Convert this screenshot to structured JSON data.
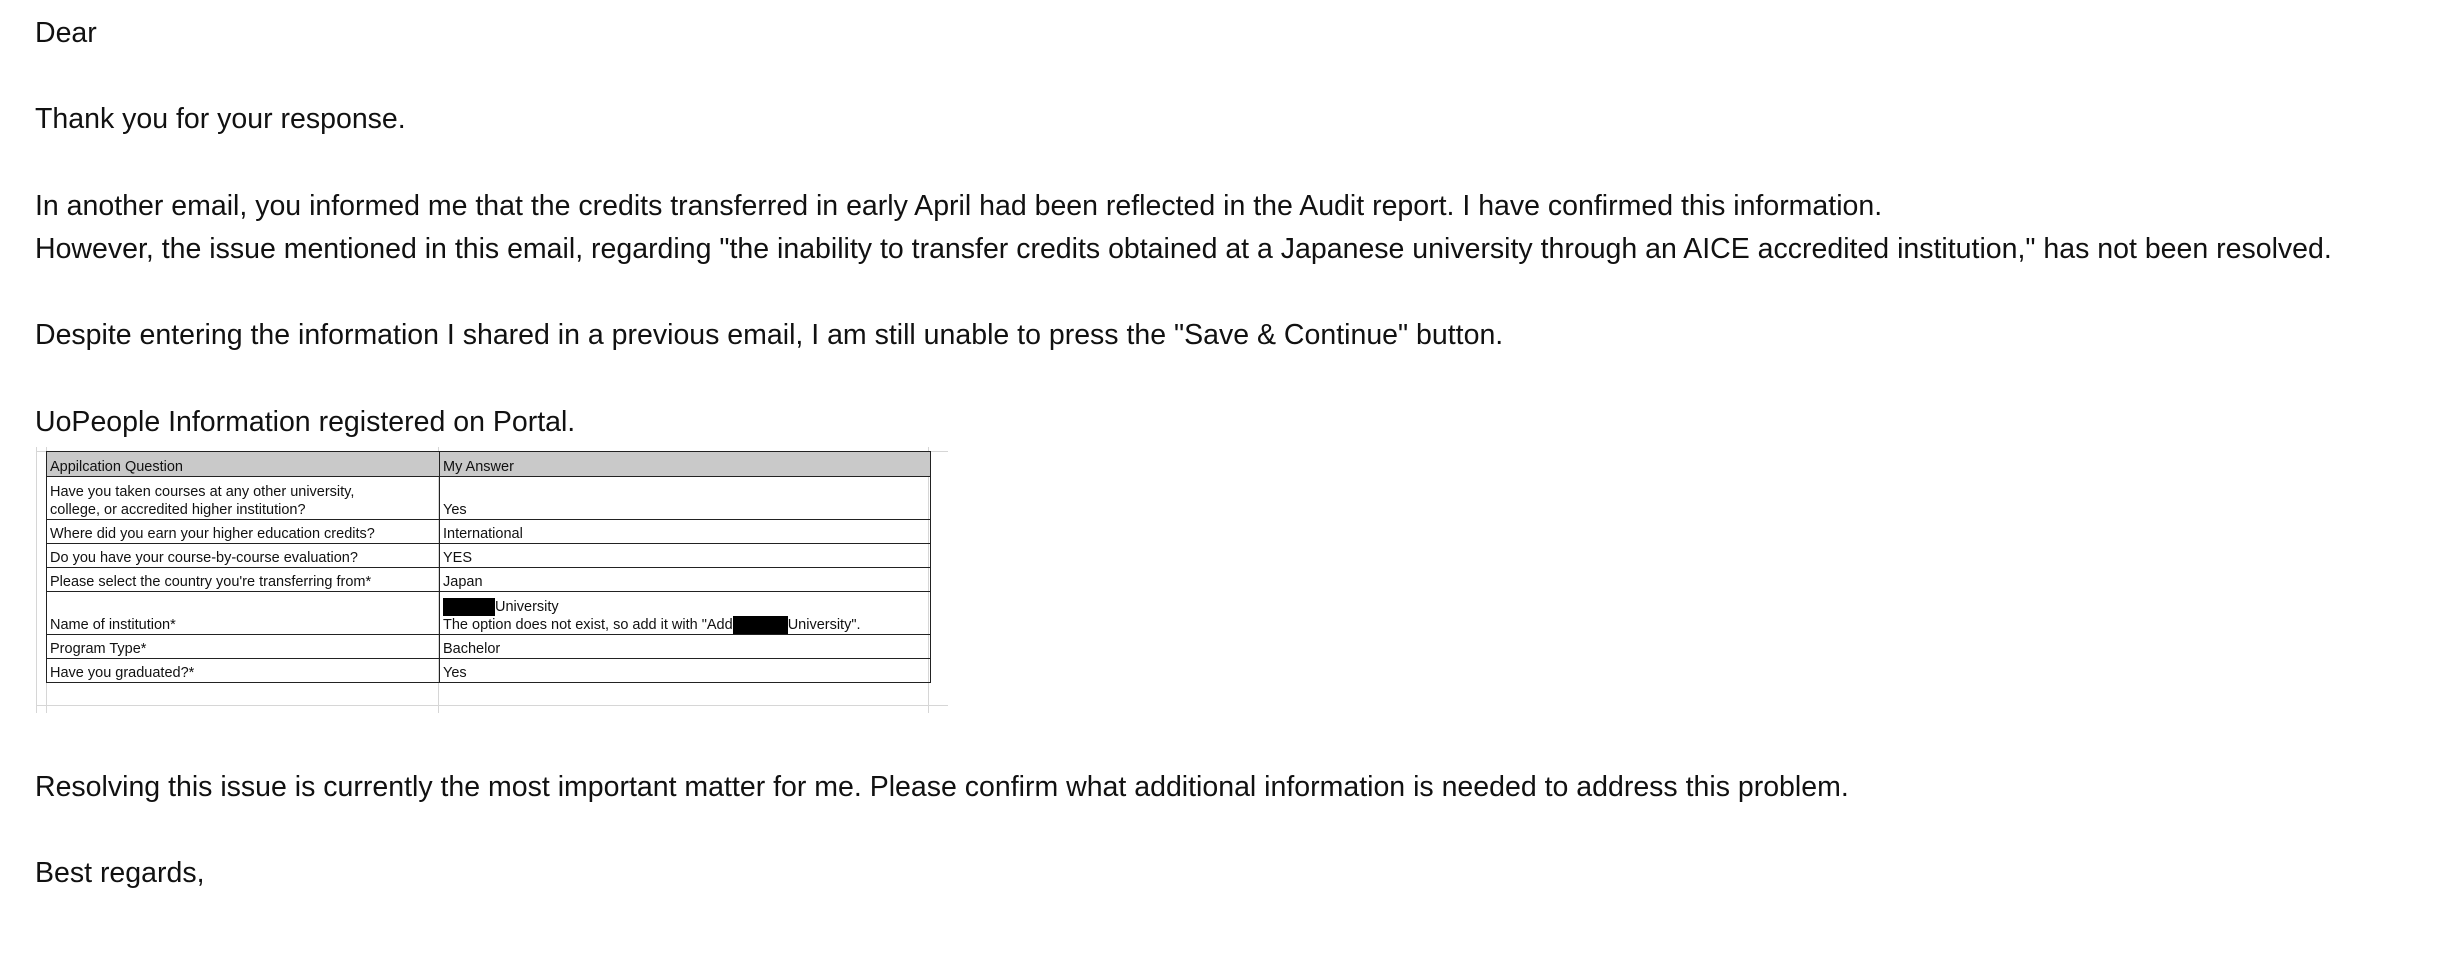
{
  "email": {
    "greeting": "Dear",
    "thanks": "Thank you for your response.",
    "para1_line1": "In another email, you informed me that the credits transferred in early April had been reflected in the Audit report. I have confirmed this information.",
    "para1_line2": "However, the issue mentioned in this email, regarding \"the inability to transfer credits obtained at a Japanese university through an AICE accredited institution,\" has not been resolved.",
    "para2": "Despite entering the information I shared in a previous email, I am still unable to press the \"Save & Continue\" button.",
    "table_intro": "UoPeople Information registered on Portal.",
    "closing_para": "Resolving this issue is currently the most important matter for me. Please confirm what additional information is needed to address this problem.",
    "signoff": "Best regards,"
  },
  "table": {
    "headers": [
      "Appilcation Question",
      "My Answer"
    ],
    "rows": [
      {
        "question_line1": "Have you taken courses at any other university,",
        "question_line2": "college, or accredited higher institution?",
        "answer": "Yes"
      },
      {
        "question": "Where did you earn your higher education credits?",
        "answer": "International"
      },
      {
        "question": "Do you have your course-by-course evaluation?",
        "answer": "YES"
      },
      {
        "question": "Please select the country you're transferring from*",
        "answer": "Japan"
      },
      {
        "question": "Name of institution*",
        "answer_line1_suffix": "University",
        "answer_line2_prefix": "The option does not exist, so add it with \"Add",
        "answer_line2_suffix": "University\"."
      },
      {
        "question": "Program Type*",
        "answer": "Bachelor"
      },
      {
        "question": "Have you graduated?*",
        "answer": "Yes"
      }
    ]
  }
}
